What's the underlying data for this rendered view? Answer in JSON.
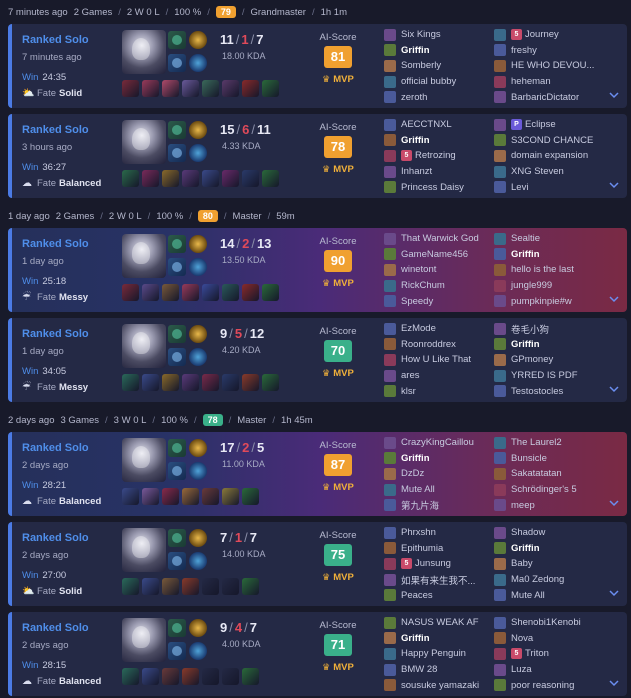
{
  "groups": [
    {
      "header": {
        "ago": "7 minutes ago",
        "games": "2 Games",
        "record": "2 W 0 L",
        "winrate": "100 %",
        "score": "79",
        "score_color": "#f0a030",
        "rank": "Grandmaster",
        "duration": "1h 1m"
      },
      "matches": [
        {
          "queue": "Ranked Solo",
          "ago": "7 minutes ago",
          "result": "Win",
          "duration": "24:35",
          "fate_label": "Fate",
          "fate": "Solid",
          "weather_icon": "partly-sunny-icon",
          "kills": "11",
          "deaths": "1",
          "assists": "7",
          "kda": "18.00 KDA",
          "ai_label": "AI-Score",
          "ai_score": "81",
          "ai_color": "#f0a030",
          "mvp": "MVP",
          "items_colors": [
            "#7a2a3a",
            "#9a3a5a",
            "#b04a6a",
            "#6a5a9a",
            "#3a6a5a",
            "#5a3a6a",
            "#8a2a2a",
            "#2a6a3a"
          ],
          "blue": [
            {
              "name": "Six Kings"
            },
            {
              "name": "Griffin",
              "me": true
            },
            {
              "name": "Somberly"
            },
            {
              "name": "official bubby"
            },
            {
              "name": "zeroth"
            }
          ],
          "red": [
            {
              "name": "Journey",
              "tag": "5",
              "tag_color": "#c84a6a"
            },
            {
              "name": "freshy"
            },
            {
              "name": "HE WHO DEVOU..."
            },
            {
              "name": "heheman"
            },
            {
              "name": "BarbaricDictator"
            }
          ]
        },
        {
          "queue": "Ranked Solo",
          "ago": "3 hours ago",
          "result": "Win",
          "duration": "36:27",
          "fate_label": "Fate",
          "fate": "Balanced",
          "weather_icon": "cloud-icon",
          "kills": "15",
          "deaths": "6",
          "assists": "11",
          "kda": "4.33 KDA",
          "ai_label": "AI-Score",
          "ai_score": "78",
          "ai_color": "#f0a030",
          "mvp": "MVP",
          "items_colors": [
            "#2a6a4a",
            "#7a2a5a",
            "#8a6a2a",
            "#5a3a7a",
            "#3a4a8a",
            "#6a2a6a",
            "#2a3a6a",
            "#2a6a3a"
          ],
          "blue": [
            {
              "name": "AECCTNXL"
            },
            {
              "name": "Griffin",
              "me": true
            },
            {
              "name": "Retrozing",
              "tag": "5",
              "tag_color": "#c84a6a"
            },
            {
              "name": "Inhanzt"
            },
            {
              "name": "Princess Daisy"
            }
          ],
          "red": [
            {
              "name": "Eclipse",
              "tag": "P",
              "tag_color": "#6a5ad8"
            },
            {
              "name": "S3COND CHANCE"
            },
            {
              "name": "domain expansion"
            },
            {
              "name": "XNG Steven"
            },
            {
              "name": "Levi"
            }
          ]
        }
      ]
    },
    {
      "header": {
        "ago": "1 day ago",
        "games": "2 Games",
        "record": "2 W 0 L",
        "winrate": "100 %",
        "score": "80",
        "score_color": "#f0a030",
        "rank": "Master",
        "duration": "59m"
      },
      "matches": [
        {
          "queue": "Ranked Solo",
          "ago": "1 day ago",
          "result": "Win",
          "duration": "25:18",
          "fate_label": "Fate",
          "fate": "Messy",
          "weather_icon": "rain-cloud-icon",
          "gradient": true,
          "kills": "14",
          "deaths": "2",
          "assists": "13",
          "kda": "13.50 KDA",
          "ai_label": "AI-Score",
          "ai_score": "90",
          "ai_color": "#f0a030",
          "mvp": "MVP",
          "items_colors": [
            "#7a2a3a",
            "#5a4a8a",
            "#7a5a3a",
            "#9a3a5a",
            "#3a4a9a",
            "#2a5a5a",
            "#8a2a2a",
            "#2a6a3a"
          ],
          "blue": [
            {
              "name": "That Warwick God"
            },
            {
              "name": "GameName456"
            },
            {
              "name": "winetont"
            },
            {
              "name": "RickChum"
            },
            {
              "name": "Speedy"
            }
          ],
          "red": [
            {
              "name": "Sealtie"
            },
            {
              "name": "Griffin",
              "me": true
            },
            {
              "name": "hello is the last"
            },
            {
              "name": "jungle999"
            },
            {
              "name": "pumpkinpie#w"
            }
          ]
        },
        {
          "queue": "Ranked Solo",
          "ago": "1 day ago",
          "result": "Win",
          "duration": "34:05",
          "fate_label": "Fate",
          "fate": "Messy",
          "weather_icon": "rain-cloud-icon",
          "kills": "9",
          "deaths": "5",
          "assists": "12",
          "kda": "4.20 KDA",
          "ai_label": "AI-Score",
          "ai_score": "70",
          "ai_color": "#3ab08a",
          "mvp": "MVP",
          "items_colors": [
            "#2a6a5a",
            "#3a4a8a",
            "#8a6a2a",
            "#5a3a7a",
            "#7a2a4a",
            "#2a3a6a",
            "#8a3a2a",
            "#2a6a3a"
          ],
          "blue": [
            {
              "name": "EzMode"
            },
            {
              "name": "Roonroddrex"
            },
            {
              "name": "How U Like That"
            },
            {
              "name": "ares"
            },
            {
              "name": "klsr"
            }
          ],
          "red": [
            {
              "name": "卷毛小狗"
            },
            {
              "name": "Griffin",
              "me": true
            },
            {
              "name": "GPmoney"
            },
            {
              "name": "YRRED IS PDF"
            },
            {
              "name": "Testostocles"
            }
          ]
        }
      ]
    },
    {
      "header": {
        "ago": "2 days ago",
        "games": "3 Games",
        "record": "3 W 0 L",
        "winrate": "100 %",
        "score": "78",
        "score_color": "#3ab08a",
        "rank": "Master",
        "duration": "1h 45m"
      },
      "matches": [
        {
          "queue": "Ranked Solo",
          "ago": "2 days ago",
          "result": "Win",
          "duration": "28:21",
          "fate_label": "Fate",
          "fate": "Balanced",
          "weather_icon": "cloud-icon",
          "gradient": true,
          "kills": "17",
          "deaths": "2",
          "assists": "5",
          "kda": "11.00 KDA",
          "ai_label": "AI-Score",
          "ai_score": "87",
          "ai_color": "#f0a030",
          "mvp": "MVP",
          "items_colors": [
            "#3a4a8a",
            "#7a5a9a",
            "#8a2a4a",
            "#9a6a3a",
            "#6a3a3a",
            "#8a7a3a",
            "#2a6a3a"
          ],
          "blue": [
            {
              "name": "CrazyKingCaillou"
            },
            {
              "name": "Griffin",
              "me": true
            },
            {
              "name": "DzDz"
            },
            {
              "name": "Mute All"
            },
            {
              "name": "第九片海"
            }
          ],
          "red": [
            {
              "name": "The Laurel2"
            },
            {
              "name": "Bunsicle"
            },
            {
              "name": "Sakatatatan"
            },
            {
              "name": "Schrödinger's 5"
            },
            {
              "name": "meep"
            }
          ]
        },
        {
          "queue": "Ranked Solo",
          "ago": "2 days ago",
          "result": "Win",
          "duration": "27:00",
          "fate_label": "Fate",
          "fate": "Solid",
          "weather_icon": "partly-sunny-icon",
          "kills": "7",
          "deaths": "1",
          "assists": "7",
          "kda": "14.00 KDA",
          "ai_label": "AI-Score",
          "ai_score": "75",
          "ai_color": "#3ab08a",
          "mvp": "MVP",
          "items_colors": [
            "#2a6a5a",
            "#3a4a8a",
            "#7a5a3a",
            "#8a3a2a",
            "#242945",
            "#242945",
            "#2a6a3a"
          ],
          "blue": [
            {
              "name": "Phrxshn"
            },
            {
              "name": "Epithumia"
            },
            {
              "name": "Junsung",
              "tag": "5",
              "tag_color": "#c84a6a"
            },
            {
              "name": "如果有来生我不..."
            },
            {
              "name": "Peaces"
            }
          ],
          "red": [
            {
              "name": "Shadow"
            },
            {
              "name": "Griffin",
              "me": true
            },
            {
              "name": "Baby"
            },
            {
              "name": "Ma0 Zedong"
            },
            {
              "name": "Mute All"
            }
          ]
        },
        {
          "queue": "Ranked Solo",
          "ago": "2 days ago",
          "result": "Win",
          "duration": "28:15",
          "fate_label": "Fate",
          "fate": "Balanced",
          "weather_icon": "cloud-icon",
          "kills": "9",
          "deaths": "4",
          "assists": "7",
          "kda": "4.00 KDA",
          "ai_label": "AI-Score",
          "ai_score": "71",
          "ai_color": "#3ab08a",
          "mvp": "MVP",
          "items_colors": [
            "#2a6a5a",
            "#3a4a8a",
            "#6a3a3a",
            "#8a3a2a",
            "#242945",
            "#242945",
            "#2a6a3a"
          ],
          "blue": [
            {
              "name": "NASUS WEAK AF"
            },
            {
              "name": "Griffin",
              "me": true
            },
            {
              "name": "Happy Penguin"
            },
            {
              "name": "BMW 28"
            },
            {
              "name": "sousuke yamazaki"
            }
          ],
          "red": [
            {
              "name": "Shenobi1Kenobi"
            },
            {
              "name": "Nova"
            },
            {
              "name": "Triton",
              "tag": "5",
              "tag_color": "#c84a6a"
            },
            {
              "name": "Luza"
            },
            {
              "name": "poor reasoning"
            }
          ]
        }
      ]
    }
  ]
}
